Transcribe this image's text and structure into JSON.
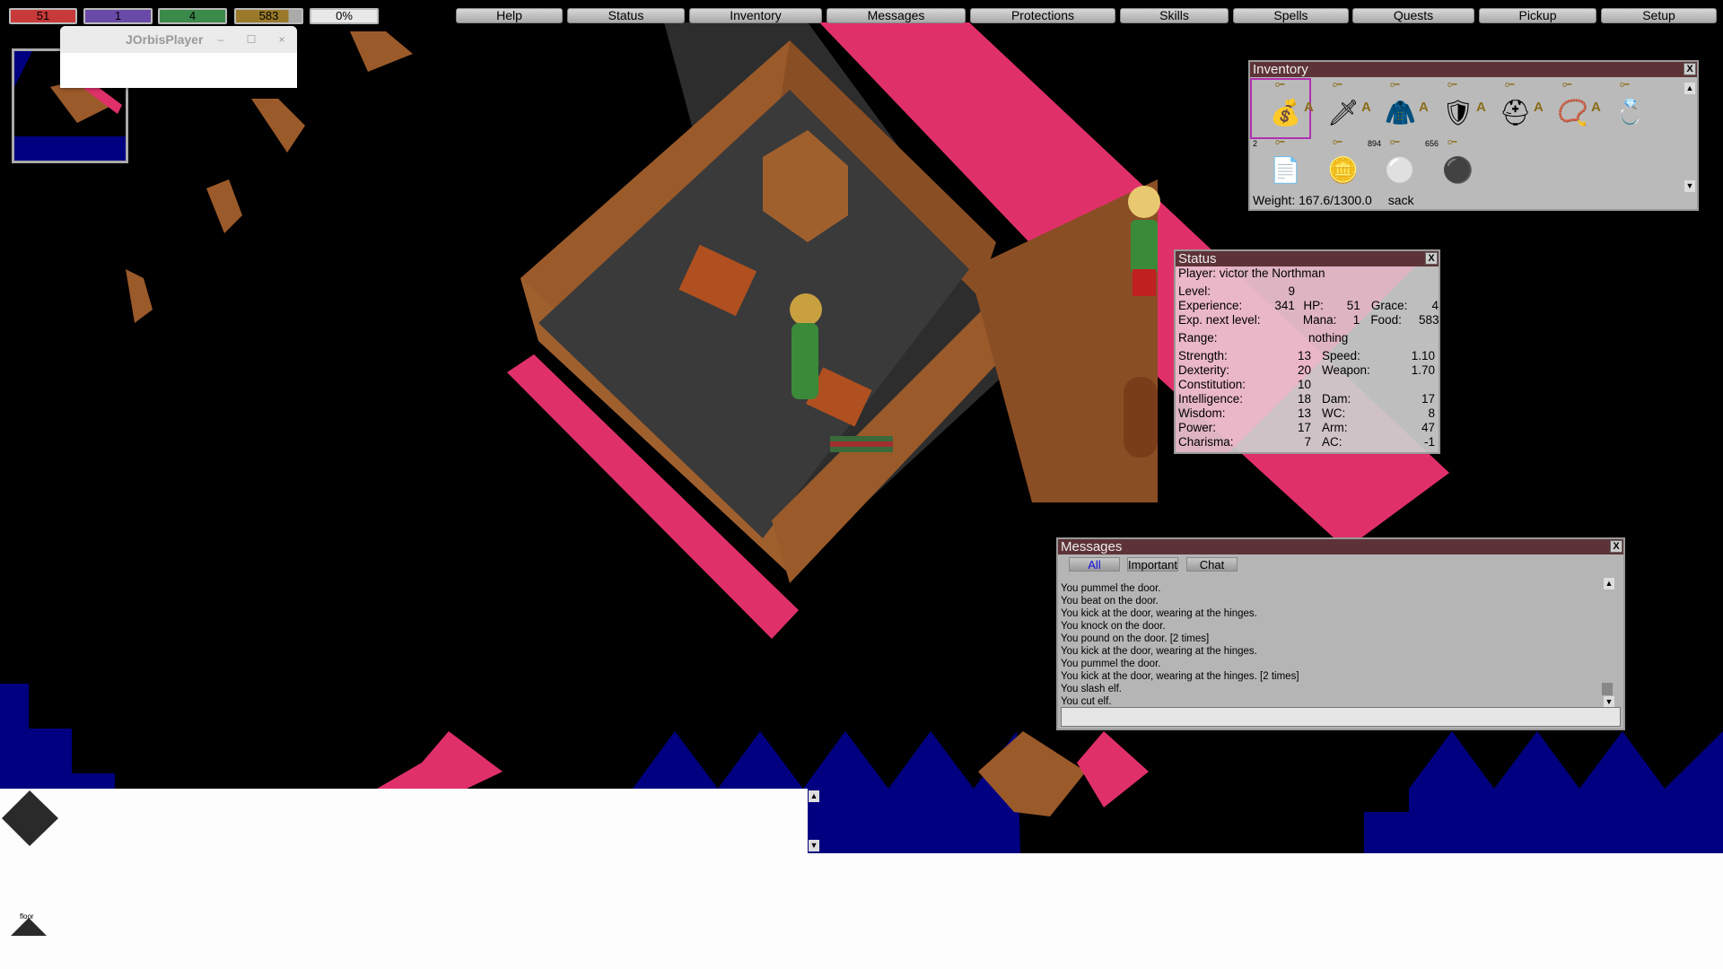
{
  "stat_bars": {
    "hp": {
      "value": "51",
      "color": "#c83a3a"
    },
    "mana": {
      "value": "1",
      "color": "#6a4aa8"
    },
    "grace": {
      "value": "4",
      "color": "#3b8a4a"
    },
    "food": {
      "value": "583",
      "color": "#9a7a2a"
    },
    "exp": {
      "value": "0%",
      "color": "#e8e8e8"
    }
  },
  "menu": [
    "Help",
    "Status",
    "Inventory",
    "Messages",
    "Protections",
    "Skills",
    "Spells",
    "Quests",
    "Pickup",
    "Setup"
  ],
  "popup_window": {
    "title": "JOrbisPlayer",
    "minimize": "–",
    "maximize": "☐",
    "close": "×"
  },
  "inventory": {
    "title": "Inventory",
    "close": "X",
    "items": [
      {
        "icon": "sack-icon",
        "glyph": "💰",
        "count": "",
        "applied": false,
        "selected": true
      },
      {
        "icon": "sword-icon",
        "glyph": "🗡",
        "count": "",
        "applied": true
      },
      {
        "icon": "armour-icon",
        "glyph": "🧥",
        "count": "",
        "applied": true
      },
      {
        "icon": "shield-icon",
        "glyph": "🛡",
        "count": "",
        "applied": true
      },
      {
        "icon": "helmet-icon",
        "glyph": "⛑",
        "count": "",
        "applied": true
      },
      {
        "icon": "amulet-icon",
        "glyph": "📿",
        "count": "",
        "applied": true
      },
      {
        "icon": "ring-icon",
        "glyph": "💍",
        "count": "",
        "applied": true
      },
      {
        "icon": "scroll-icon",
        "glyph": "📄",
        "count": "2",
        "applied": false
      },
      {
        "icon": "gold-coins-icon",
        "glyph": "🪙",
        "count": "",
        "applied": false
      },
      {
        "icon": "silver-coins-icon",
        "glyph": "⚪",
        "count": "894",
        "applied": false
      },
      {
        "icon": "platinum-coins-icon",
        "glyph": "⚫",
        "count": "656",
        "applied": false
      }
    ],
    "applied_marker": "A",
    "locked_marker": "o━",
    "weight": "Weight: 167.6/1300.0",
    "container": "sack"
  },
  "status": {
    "title": "Status",
    "close": "X",
    "player": "Player: victor the Northman",
    "level_label": "Level:",
    "level": "9",
    "rows_top": [
      {
        "l1": "Experience:",
        "v1": "341",
        "l2": "HP:",
        "v2": "51",
        "l3": "Grace:",
        "v3": "4"
      },
      {
        "l1": "Exp. next level:",
        "v1": "",
        "l2": "Mana:",
        "v2": "1",
        "l3": "Food:",
        "v3": "583"
      }
    ],
    "range_label": "Range:",
    "range": "nothing",
    "rows_stats": [
      {
        "l": "Strength:",
        "v": "13",
        "l2": "Speed:",
        "v2": "1.10"
      },
      {
        "l": "Dexterity:",
        "v": "20",
        "l2": "Weapon:",
        "v2": "1.70"
      },
      {
        "l": "Constitution:",
        "v": "10",
        "l2": "",
        "v2": ""
      },
      {
        "l": "Intelligence:",
        "v": "18",
        "l2": "Dam:",
        "v2": "17"
      },
      {
        "l": "Wisdom:",
        "v": "13",
        "l2": "WC:",
        "v2": "8"
      },
      {
        "l": "Power:",
        "v": "17",
        "l2": "Arm:",
        "v2": "47"
      },
      {
        "l": "Charisma:",
        "v": "7",
        "l2": "AC:",
        "v2": "-1"
      }
    ]
  },
  "messages": {
    "title": "Messages",
    "close": "X",
    "tabs": [
      "All",
      "Important",
      "Chat"
    ],
    "active_tab": "All",
    "lines": [
      "You pummel the door.",
      "You beat on the door.",
      "You kick at the door, wearing at the hinges.",
      "You knock on the door.",
      "You pound on the door. [2 times]",
      "You kick at the door, wearing at the hinges.",
      "You pummel the door.",
      "You kick at the door, wearing at the hinges. [2 times]",
      "You slash elf.",
      "You cut elf."
    ],
    "input_value": ""
  },
  "floor_label": "floor"
}
